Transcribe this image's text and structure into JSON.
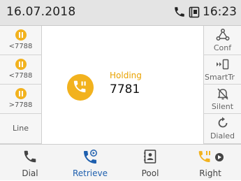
{
  "status_bar": {
    "date": "16.07.2018",
    "time": "16:23",
    "icons": [
      "phone-icon",
      "phonebook-icon"
    ]
  },
  "line_keys": [
    {
      "label": "<7788",
      "icon": "hold-icon",
      "state": "held"
    },
    {
      "label": "<7788",
      "icon": "hold-icon",
      "state": "held"
    },
    {
      "label": ">7788",
      "icon": "hold-icon",
      "state": "held"
    },
    {
      "label": "Line",
      "icon": "",
      "state": "idle"
    }
  ],
  "function_keys": [
    {
      "label": "Conf",
      "icon": "conference-icon"
    },
    {
      "label": "SmartTr",
      "icon": "smart-transfer-icon"
    },
    {
      "label": "Silent",
      "icon": "silent-bell-icon"
    },
    {
      "label": "Dialed",
      "icon": "redial-icon"
    }
  ],
  "call": {
    "state": "Holding",
    "number": "7781",
    "icon": "call-hold-icon"
  },
  "softkeys": [
    {
      "label": "Dial",
      "icon": "handset-icon",
      "active": false
    },
    {
      "label": "Retrieve",
      "icon": "retrieve-icon",
      "active": true
    },
    {
      "label": "Pool",
      "icon": "directory-icon",
      "active": false
    },
    {
      "label": "Right",
      "icon": "hold-call-next-icon",
      "active": false
    }
  ],
  "colors": {
    "accent_hold": "#f2b21e",
    "accent_active": "#1e5fae",
    "status_bar": "#e4e4e4"
  }
}
